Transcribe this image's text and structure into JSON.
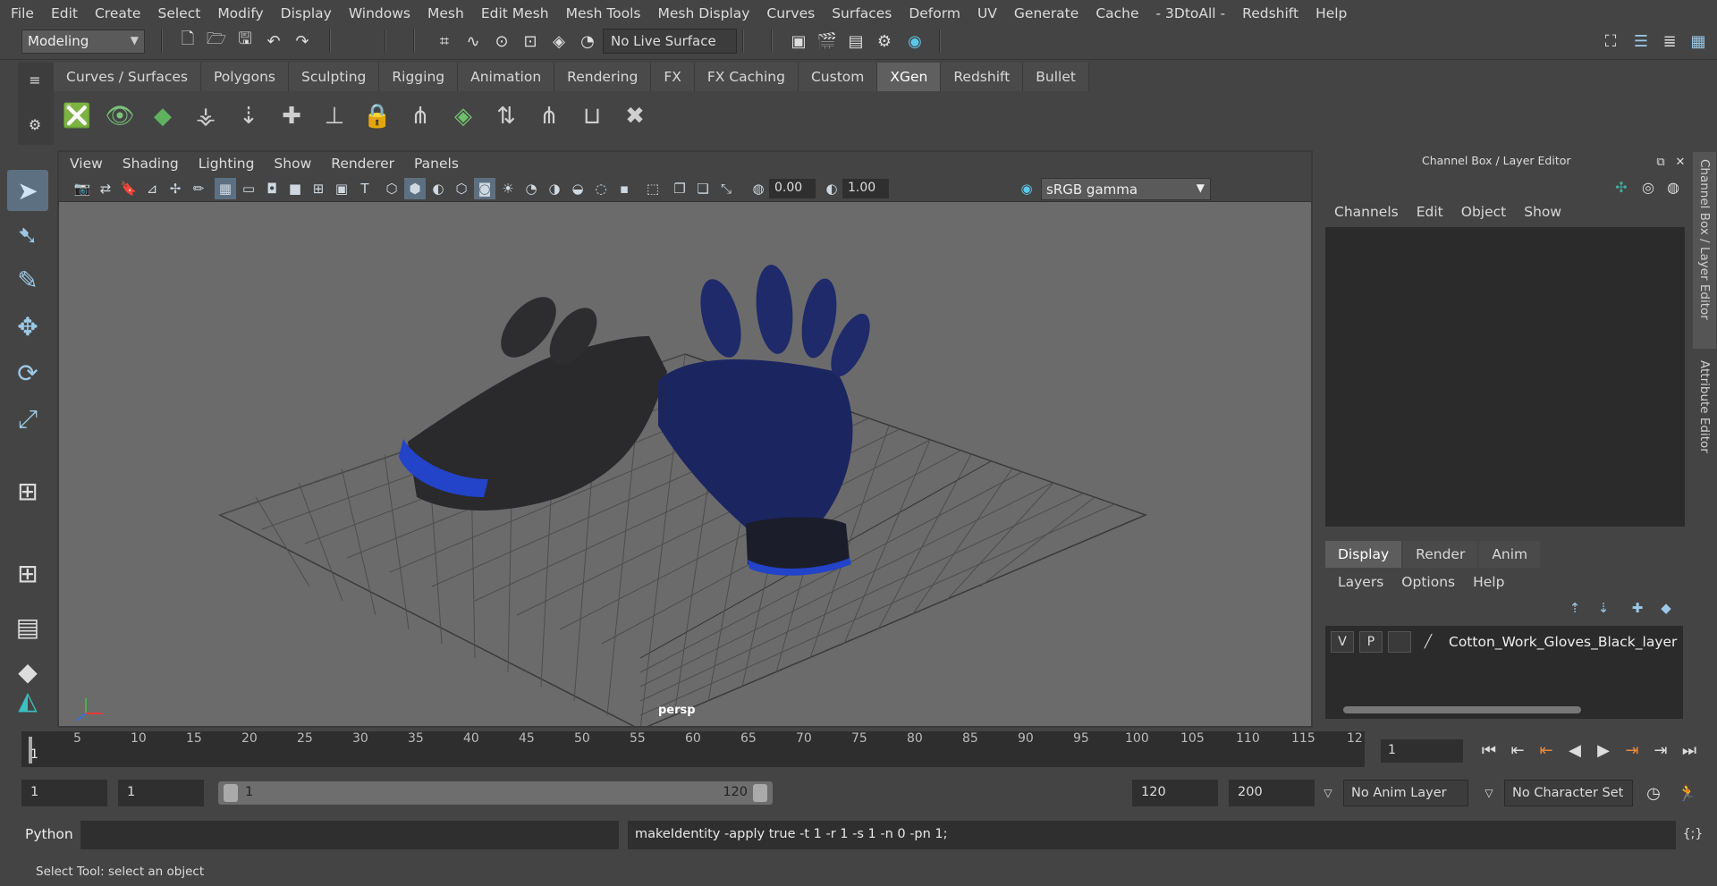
{
  "menubar": [
    "File",
    "Edit",
    "Create",
    "Select",
    "Modify",
    "Display",
    "Windows",
    "Mesh",
    "Edit Mesh",
    "Mesh Tools",
    "Mesh Display",
    "Curves",
    "Surfaces",
    "Deform",
    "UV",
    "Generate",
    "Cache",
    "- 3DtoAll -",
    "Redshift",
    "Help"
  ],
  "toolbar": {
    "mode": "Modeling",
    "live_surface": "No Live Surface"
  },
  "shelf_tabs": [
    "Curves / Surfaces",
    "Polygons",
    "Sculpting",
    "Rigging",
    "Animation",
    "Rendering",
    "FX",
    "FX Caching",
    "Custom",
    "XGen",
    "Redshift",
    "Bullet"
  ],
  "active_shelf_tab": "XGen",
  "viewport": {
    "menu": [
      "View",
      "Shading",
      "Lighting",
      "Show",
      "Renderer",
      "Panels"
    ],
    "exposure": "0.00",
    "gamma": "1.00",
    "colorspace": "sRGB gamma",
    "camera_label": "persp"
  },
  "channel_box": {
    "title": "Channel Box / Layer Editor",
    "menu": [
      "Channels",
      "Edit",
      "Object",
      "Show"
    ]
  },
  "side_tabs": {
    "channel_box": "Channel Box / Layer Editor",
    "attribute_editor": "Attribute Editor"
  },
  "layer_editor": {
    "tabs": [
      "Display",
      "Render",
      "Anim"
    ],
    "active_tab": "Display",
    "menu": [
      "Layers",
      "Options",
      "Help"
    ],
    "layer": {
      "v": "V",
      "p": "P",
      "name": "Cotton_Work_Gloves_Black_layer"
    }
  },
  "timeline": {
    "ticks": [
      "1",
      "5",
      "10",
      "15",
      "20",
      "25",
      "30",
      "35",
      "40",
      "45",
      "50",
      "55",
      "60",
      "65",
      "70",
      "75",
      "80",
      "85",
      "90",
      "95",
      "100",
      "105",
      "110",
      "115",
      "12"
    ],
    "current_frame": "1"
  },
  "range": {
    "start": "1",
    "playback_start": "1",
    "slider_start": "1",
    "slider_end": "120",
    "playback_end": "120",
    "end": "200",
    "anim_layer": "No Anim Layer",
    "character_set": "No Character Set"
  },
  "command": {
    "language": "Python",
    "output": "makeIdentity -apply true -t 1 -r 1 -s 1 -n 0 -pn 1;"
  },
  "status": "Select Tool: select an object"
}
